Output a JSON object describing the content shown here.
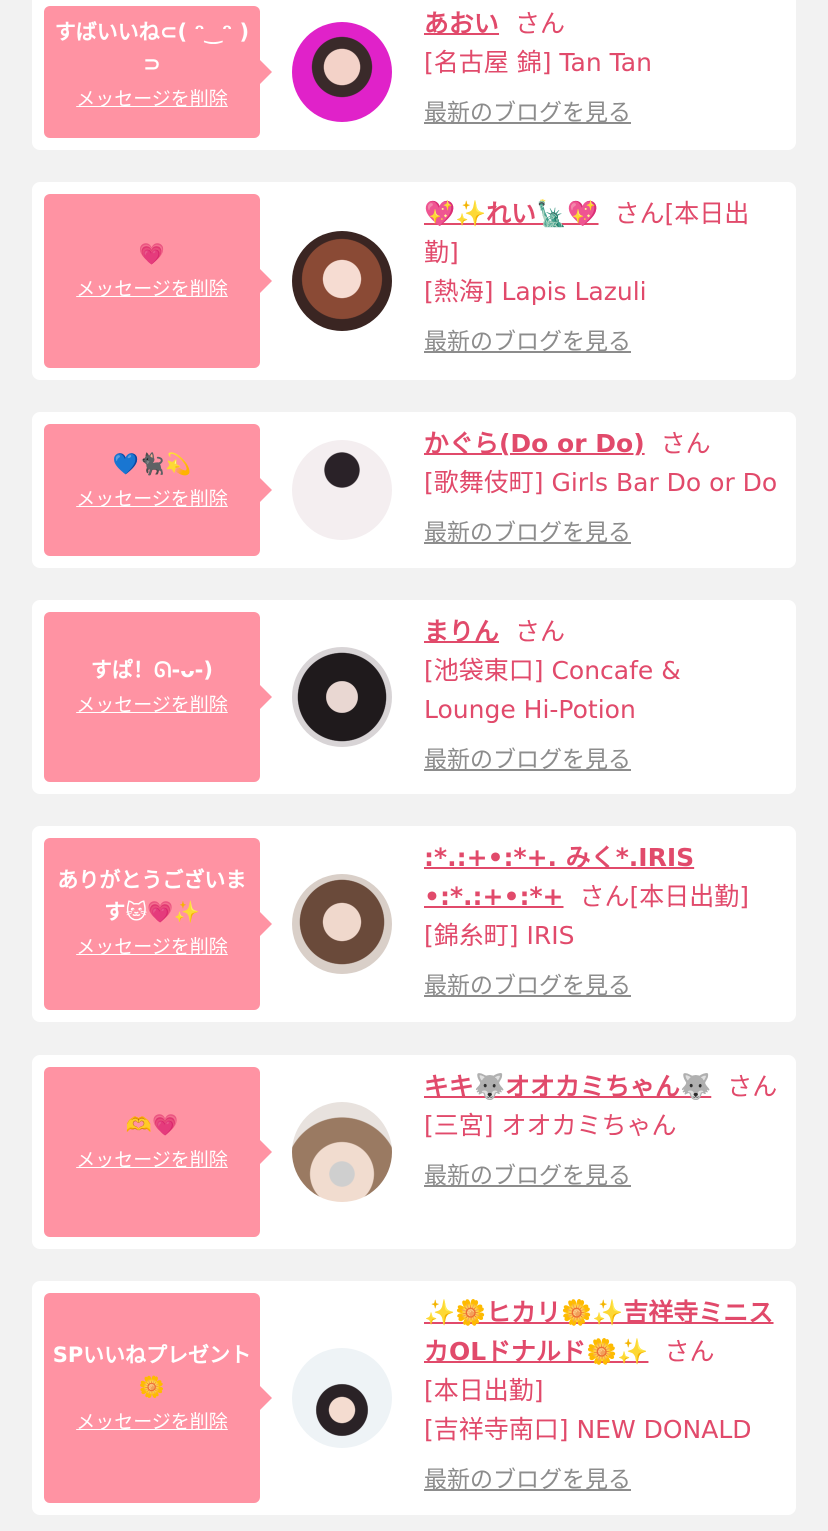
{
  "san_label": "さん",
  "delete_label": "メッセージを削除",
  "blog_label": "最新のブログを見る",
  "colors": {
    "bubble": "#ff93a3",
    "name": "#e14a6b",
    "link_gray": "#8c8c8c",
    "background": "#f2f2f2"
  },
  "entries": [
    {
      "message": "すばいいね⊂( ᵔ‿ᵔ )⊃",
      "name": "あおい",
      "extra": "",
      "shop": "[名古屋 錦] Tan Tan"
    },
    {
      "message": "💗",
      "name": "💖✨れい🗽💖",
      "extra": "[本日出勤]",
      "shop": "[熱海] Lapis Lazuli"
    },
    {
      "message": "💙🐈‍⬛💫",
      "name": "かぐら(Do or Do)",
      "extra": "",
      "shop": "[歌舞伎町] Girls Bar Do or Do"
    },
    {
      "message": "すぱ！ᘏ-ᴗ-)",
      "name": "まりん",
      "extra": "",
      "shop": "[池袋東口] Concafe & Lounge Hi-Potion"
    },
    {
      "message": "ありがとうございます🐱💗✨",
      "name": ":*.:+•:*+. みく*.IRIS •:*.:+•:*+",
      "extra": "[本日出勤]",
      "shop": "[錦糸町] IRIS"
    },
    {
      "message": "🫶💗",
      "name": "キキ🐺オオカミちゃん🐺",
      "extra": "",
      "shop": "[三宮] オオカミちゃん"
    },
    {
      "message": "SPいいねプレゼント🌼",
      "name": "✨🌼ヒカリ🌼✨吉祥寺ミニスカOLドナルド🌼✨",
      "extra": "[本日出勤]",
      "shop": "[吉祥寺南口] NEW DONALD"
    }
  ]
}
